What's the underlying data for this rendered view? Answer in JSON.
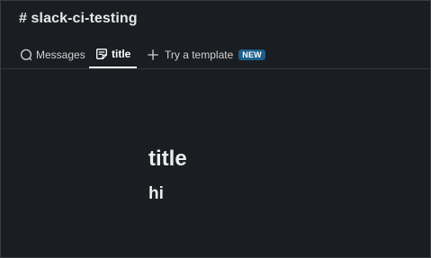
{
  "channel": {
    "title": "# slack-ci-testing"
  },
  "tabs": {
    "messages": {
      "label": "Messages",
      "icon": "chat-bubble-icon"
    },
    "canvas": {
      "label": "title",
      "icon": "canvas-icon",
      "active": true
    },
    "template": {
      "label": "Try a template",
      "icon": "plus-icon",
      "badge": "NEW"
    }
  },
  "canvas": {
    "heading": "title",
    "subheading": "hi"
  },
  "colors": {
    "background": "#1a1d21",
    "badge": "#1d5f8a",
    "active_tab_underline": "#ffffff"
  }
}
